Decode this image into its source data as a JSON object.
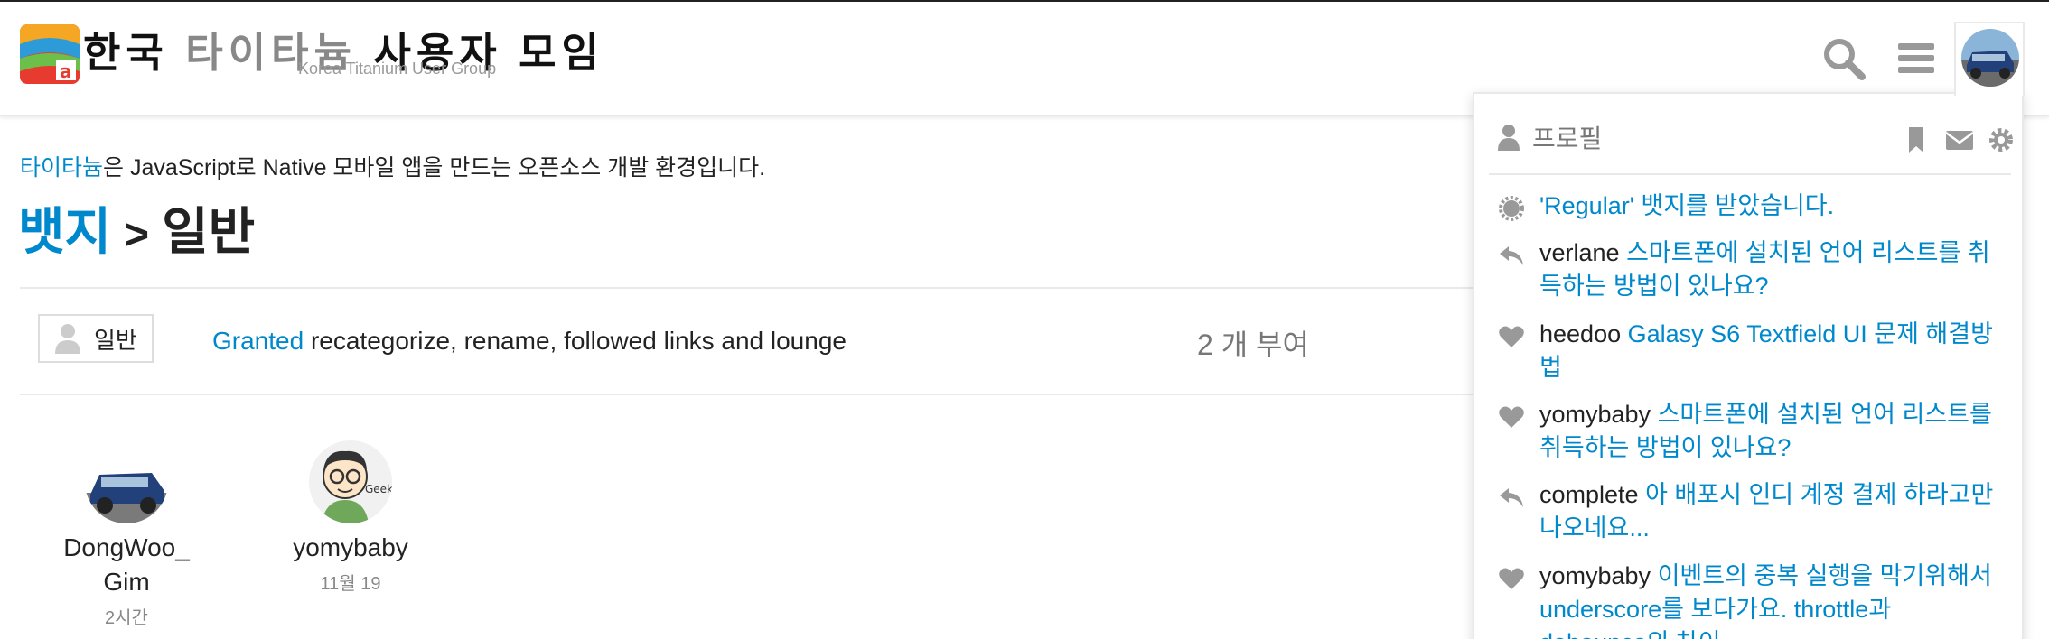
{
  "header": {
    "title_part1": "한국",
    "title_part2": "타이타늄",
    "title_part3": "사용자 모임",
    "subtitle": "Korea Titanium User Group"
  },
  "intro": {
    "link": "타이타늄",
    "text": "은 JavaScript로 Native 모바일 앱을 만드는 오픈소스 개발 환경입니다."
  },
  "breadcrumb": {
    "parent": "뱃지",
    "separator": ">",
    "current": "일반"
  },
  "badge": {
    "name": "일반",
    "granted_link": "Granted",
    "description": " recategorize, rename, followed links and lounge",
    "granted_count": "2 개 부여"
  },
  "users": [
    {
      "name": "DongWoo_ Gim",
      "time": "2시간"
    },
    {
      "name": "yomybaby",
      "time": "11월 19"
    }
  ],
  "dropdown": {
    "profile_label": "프로필",
    "notifications": [
      {
        "icon": "badge-icon",
        "user": "",
        "text": "'Regular' 뱃지를 받았습니다."
      },
      {
        "icon": "reply-icon",
        "user": "verlane",
        "text": "스마트폰에 설치된 언어 리스트를 취득하는 방법이 있나요?"
      },
      {
        "icon": "heart-icon",
        "user": "heedoo",
        "text": "Galasy S6 Textfield UI 문제 해결방법"
      },
      {
        "icon": "heart-icon",
        "user": "yomybaby",
        "text": "스마트폰에 설치된 언어 리스트를 취득하는 방법이 있나요?"
      },
      {
        "icon": "reply-icon",
        "user": "complete",
        "text": "아 배포시 인디 계정 결제 하라고만 나오네요..."
      },
      {
        "icon": "heart-icon",
        "user": "yomybaby",
        "text": "이벤트의 중복 실행을 막기위해서 underscore를 보다가요. throttle과 debounce의 차이"
      }
    ]
  },
  "colors": {
    "link": "#0088cc",
    "text": "#222222",
    "muted": "#777777"
  }
}
